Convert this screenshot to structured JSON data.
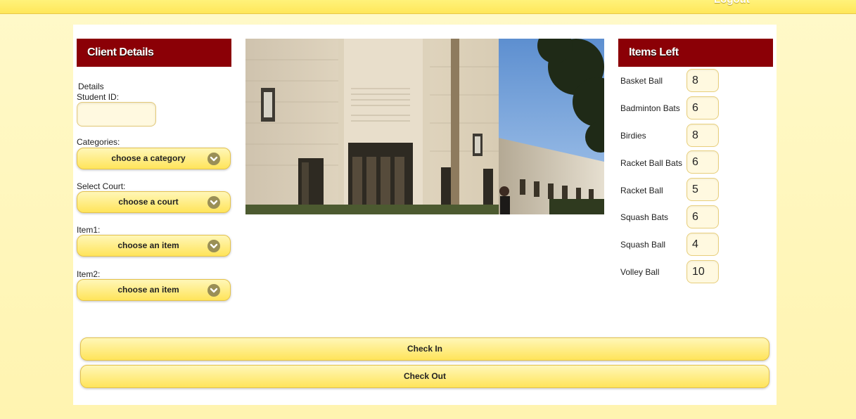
{
  "topbar": {
    "logout_label": "Logout"
  },
  "client_details": {
    "header": "Client Details",
    "details_label": "Details",
    "student_id_label": "Student ID:",
    "student_id_value": "",
    "categories_label": "Categories:",
    "category_select": "choose a category",
    "court_label": "Select Court:",
    "court_select": "choose a court",
    "item1_label": "Item1:",
    "item1_select": "choose an item",
    "item2_label": "Item2:",
    "item2_select": "choose an item"
  },
  "image": {
    "alt": "Gymnasium building entrance"
  },
  "items_left": {
    "header": "Items Left",
    "items": [
      {
        "name": "Basket Ball",
        "qty": "8"
      },
      {
        "name": "Badminton Bats",
        "qty": "6"
      },
      {
        "name": "Birdies",
        "qty": "8"
      },
      {
        "name": "Racket Ball Bats",
        "qty": "6"
      },
      {
        "name": "Racket Ball",
        "qty": "5"
      },
      {
        "name": "Squash Bats",
        "qty": "6"
      },
      {
        "name": "Squash Ball",
        "qty": "4"
      },
      {
        "name": "Volley Ball",
        "qty": "10"
      }
    ]
  },
  "actions": {
    "check_in": "Check In",
    "check_out": "Check Out"
  },
  "colors": {
    "header_bg": "#8b0006",
    "button_yellow": "#ffe45a",
    "page_bg": "#fff9c9"
  }
}
